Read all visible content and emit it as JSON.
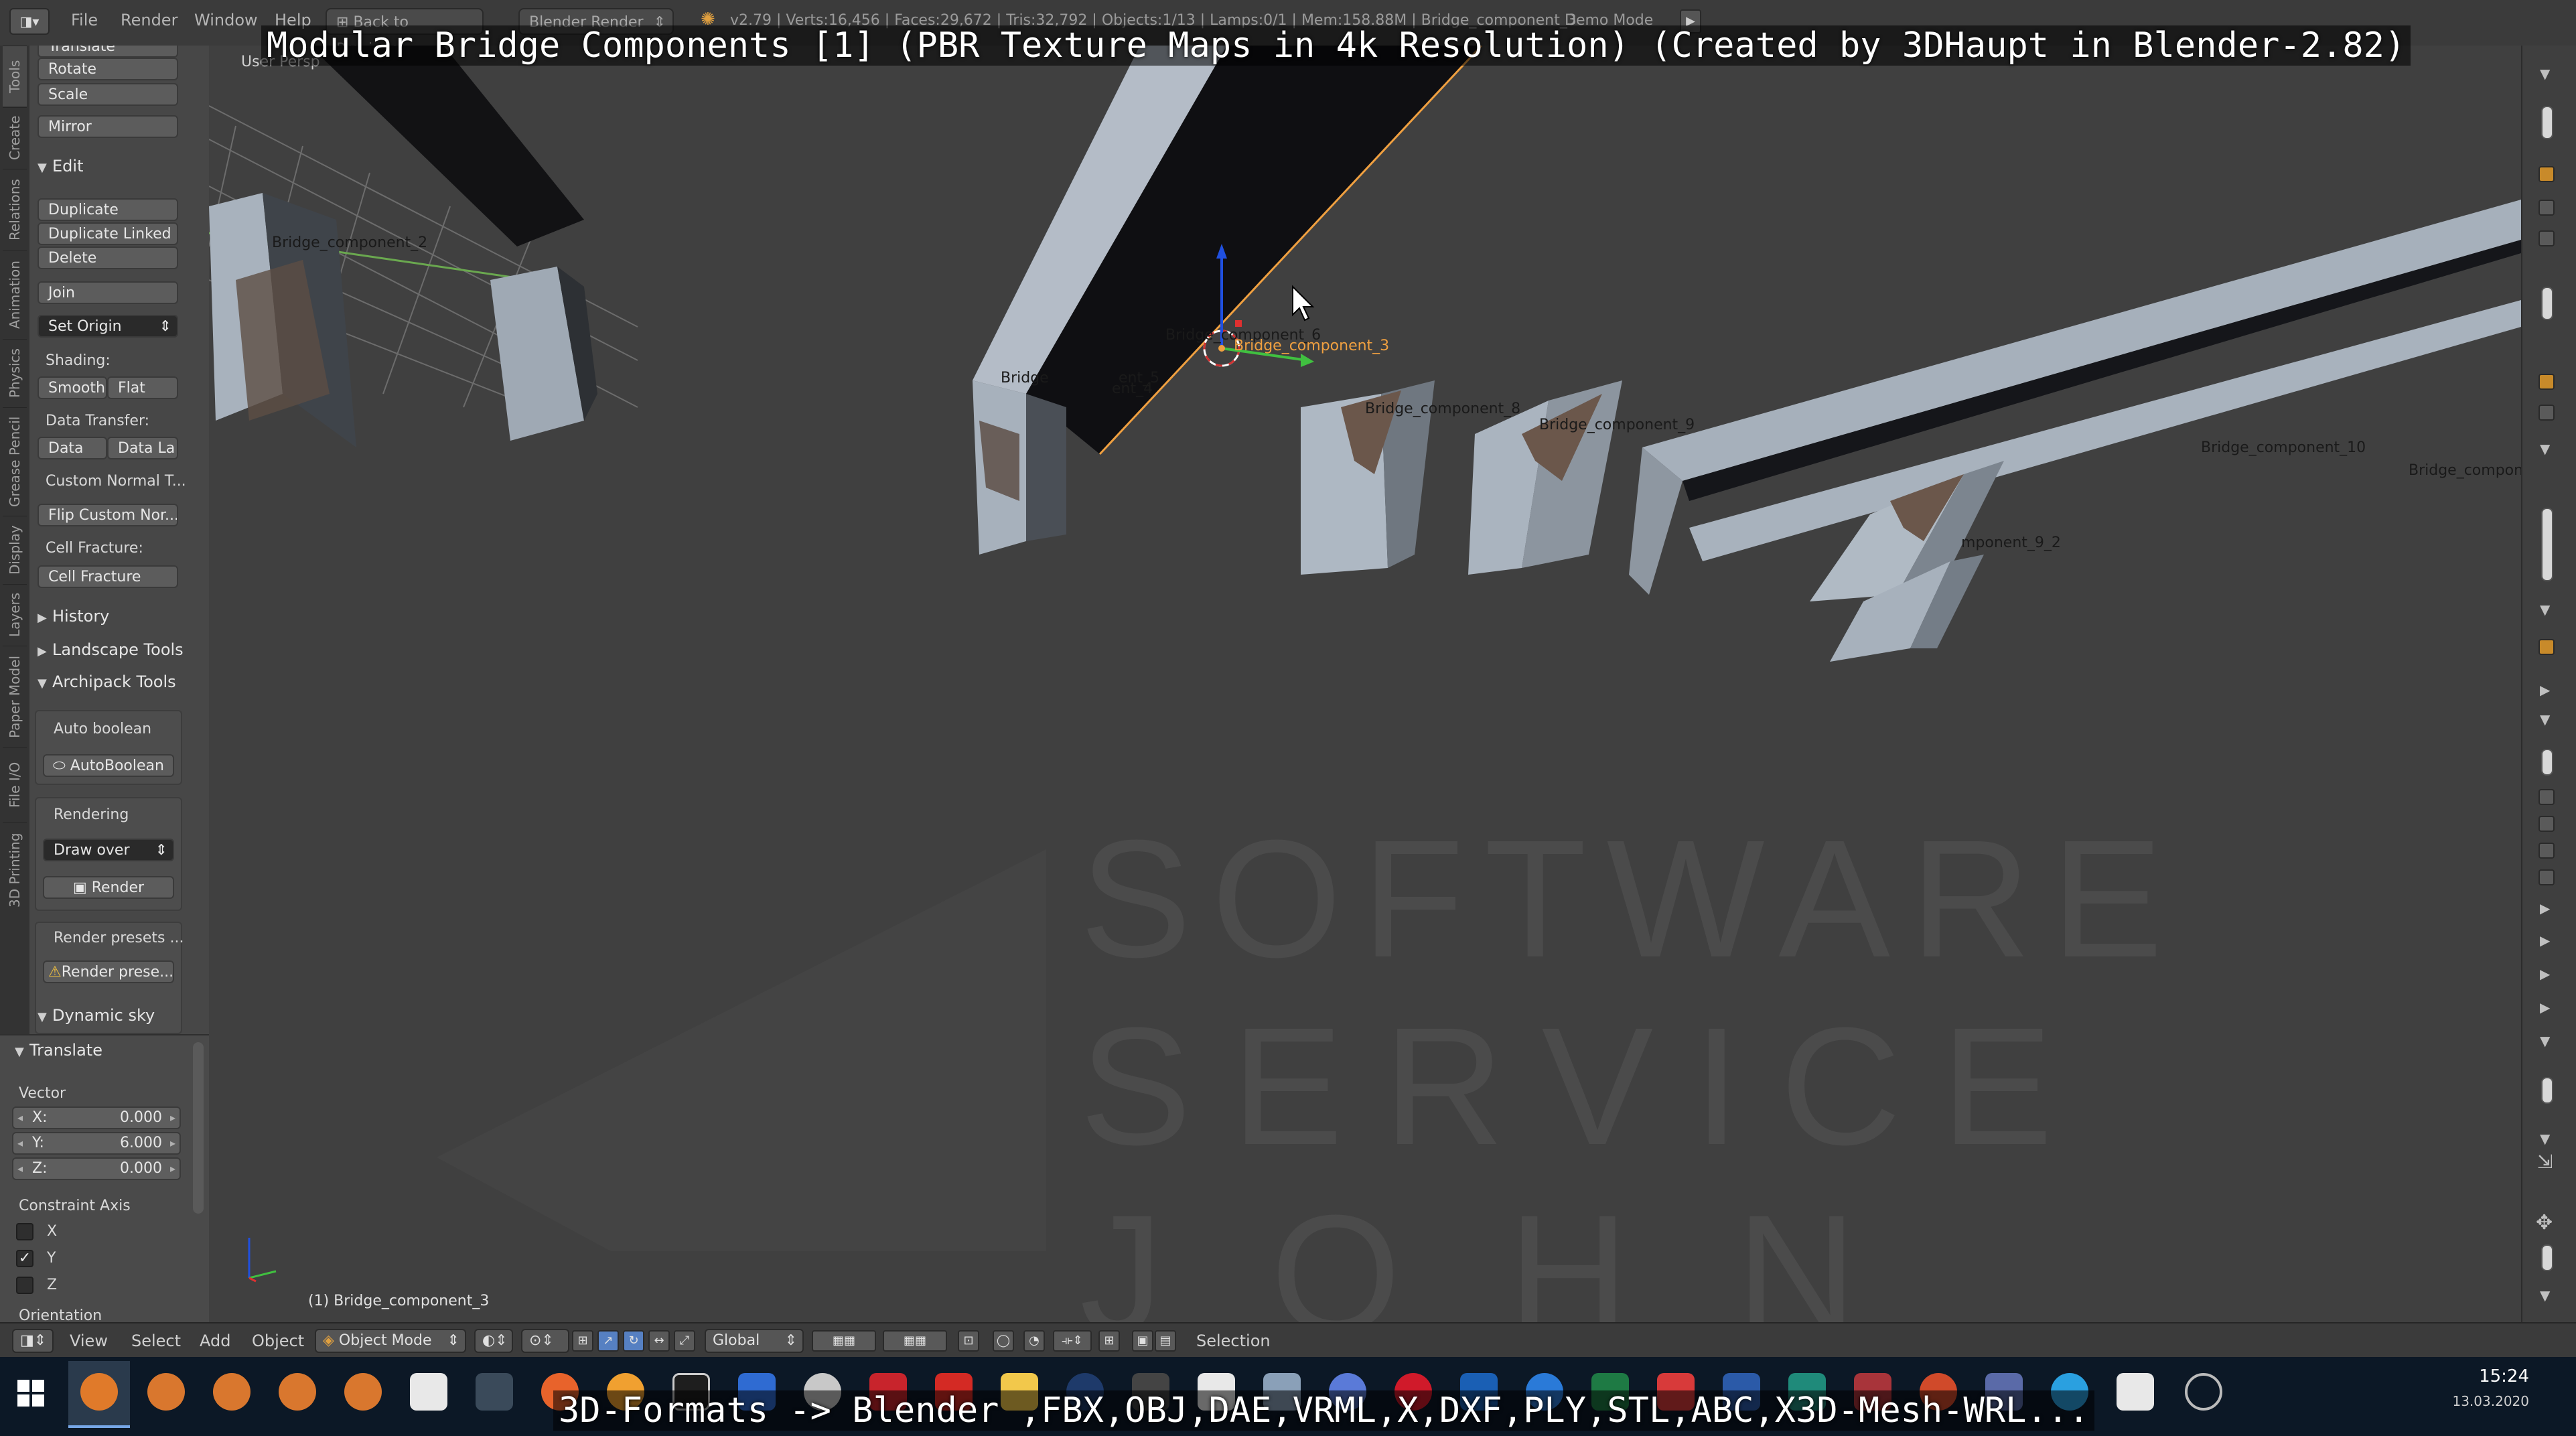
{
  "overlays": {
    "title": "Modular Bridge Components [1] (PBR Texture Maps in 4k Resolution) (Created by 3DHaupt in Blender-2.82)",
    "bottom": "3D-Formats -> Blender ,FBX,OBJ,DAE,VRML,X,DXF,PLY,STL,ABC,X3D-Mesh-WRL..."
  },
  "topbar": {
    "menu": [
      "File",
      "Render",
      "Window",
      "Help"
    ],
    "back_button": "Back to Previous",
    "engine": "Blender Render",
    "stats": "v2.79 | Verts:16,456 | Faces:29,672 | Tris:32,792 | Objects:1/13 | Lamps:0/1 | Mem:158.88M | Bridge_component_3",
    "demo_mode": "Demo Mode"
  },
  "left_tabs": [
    "Tools",
    "Create",
    "Relations",
    "Animation",
    "Physics",
    "Grease Pencil",
    "Display",
    "Layers",
    "Paper Model",
    "File I/O",
    "3D Printing"
  ],
  "shelf": {
    "transform_items": [
      "Translate",
      "Rotate",
      "Scale",
      "Mirror"
    ],
    "edit_header": "Edit",
    "edit_items": [
      "Duplicate",
      "Duplicate Linked",
      "Delete"
    ],
    "join": "Join",
    "set_origin": "Set Origin",
    "shading_label": "Shading:",
    "smooth": "Smooth",
    "flat": "Flat",
    "data_transfer_label": "Data Transfer:",
    "data": "Data",
    "data_la": "Data La",
    "custom_normal": "Custom Normal T...",
    "flip_custom": "Flip Custom Nor...",
    "cell_fracture_label": "Cell Fracture:",
    "cell_fracture": "Cell Fracture",
    "history": "History",
    "landscape_tools": "Landscape Tools",
    "archipack_tools": "Archipack Tools",
    "auto_boolean_label": "Auto boolean",
    "auto_boolean_btn": "AutoBoolean",
    "rendering_label": "Rendering",
    "draw_over": "Draw over",
    "render_btn": "Render",
    "render_presets_label": "Render presets ...",
    "render_presets_btn": "Render prese...",
    "dynamic_sky": "Dynamic sky"
  },
  "translate_panel": {
    "header": "Translate",
    "vector_label": "Vector",
    "x_label": "X:",
    "x_value": "0.000",
    "y_label": "Y:",
    "y_value": "6.000",
    "z_label": "Z:",
    "z_value": "0.000",
    "constraint_label": "Constraint Axis",
    "axes": [
      "X",
      "Y",
      "Z"
    ],
    "axes_checked": [
      false,
      true,
      false
    ],
    "orientation_label": "Orientation"
  },
  "viewport": {
    "view_label": "User Persp",
    "active_object": "(1) Bridge_component_3",
    "watermark": [
      "SOFTWARE",
      "SERVICE",
      "JOHN"
    ],
    "labels": {
      "c2": "Bridge_component_2",
      "c3": "Bridge_component_3",
      "c6": "Bridge_component_6",
      "c8": "Bridge_component_8",
      "c9": "Bridge_component_9",
      "c10": "Bridge_component_10",
      "c11": "Bridge_compone",
      "c92": "mponent_9_2",
      "cb1": "Bridge",
      "cb2": "ent_5",
      "cb3": "ent_4"
    }
  },
  "viewport_header": {
    "menu": [
      "View",
      "Select",
      "Add",
      "Object"
    ],
    "mode": "Object Mode",
    "orientation": "Global",
    "selection_label": "Selection"
  },
  "taskbar": {
    "time": "15:24",
    "date": "13.03.2020"
  },
  "colors": {
    "viewport_bg": "#404040",
    "shelf_bg": "#474747",
    "taskbar_bg": "#0c1826",
    "selection_orange": "#f0a040",
    "beam_top": "#aab4c0",
    "beam_side": "#0f0f12"
  }
}
